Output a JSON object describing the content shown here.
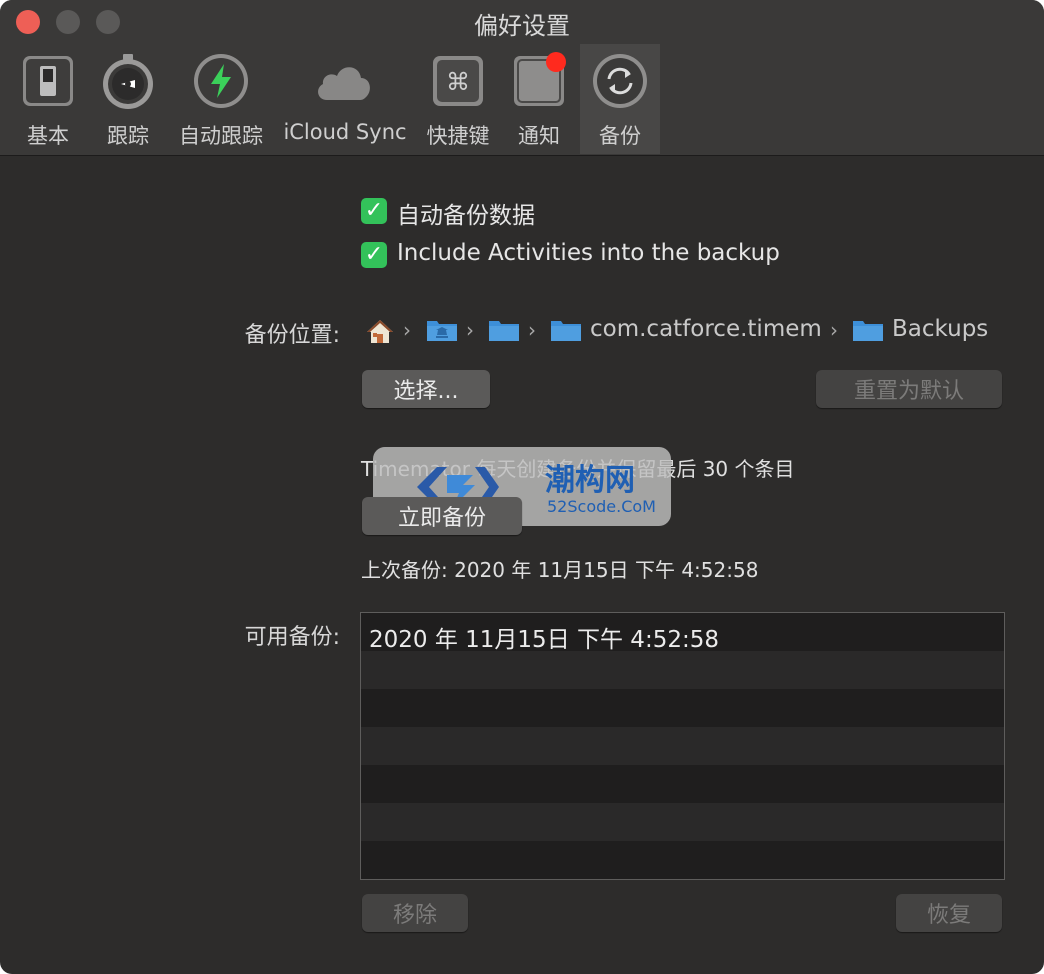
{
  "window": {
    "title": "偏好设置"
  },
  "tabs": [
    {
      "label": "基本",
      "icon": "switch-icon"
    },
    {
      "label": "跟踪",
      "icon": "stopwatch-icon"
    },
    {
      "label": "自动跟踪",
      "icon": "lightning-icon"
    },
    {
      "label": "iCloud Sync",
      "icon": "cloud-icon"
    },
    {
      "label": "快捷键",
      "icon": "command-key-icon"
    },
    {
      "label": "通知",
      "icon": "notification-icon",
      "badge": true
    },
    {
      "label": "备份",
      "icon": "sync-arrows-icon",
      "selected": true
    }
  ],
  "options": {
    "auto_backup": {
      "label": "自动备份数据",
      "checked": true
    },
    "include_activities": {
      "label": "Include Activities into the backup",
      "checked": true
    }
  },
  "location": {
    "label": "备份位置:",
    "path": [
      {
        "type": "home-icon"
      },
      {
        "type": "folder-icon"
      },
      {
        "type": "folder-icon"
      },
      {
        "type": "folder-icon",
        "text": "com.catforce.timem"
      },
      {
        "type": "folder-icon",
        "text": "Backups"
      }
    ],
    "choose_button": "选择...",
    "reset_button": "重置为默认"
  },
  "schedule": {
    "description": "Timemator 每天创建备份并保留最后 30 个条目",
    "backup_now_button": "立即备份",
    "last_backup": "上次备份: 2020 年 11月15日 下午 4:52:58"
  },
  "available": {
    "label": "可用备份:",
    "items": [
      "2020 年 11月15日 下午 4:52:58"
    ],
    "remove_button": "移除",
    "restore_button": "恢复"
  },
  "watermark": {
    "text_main": "潮构网",
    "text_sub": "52Scode.CoM"
  },
  "colors": {
    "window_bg": "#2d2c2b",
    "checkbox": "#33c25a",
    "folder": "#4f9ee0",
    "close": "#ee5f56",
    "badge": "#ff2a1e"
  }
}
